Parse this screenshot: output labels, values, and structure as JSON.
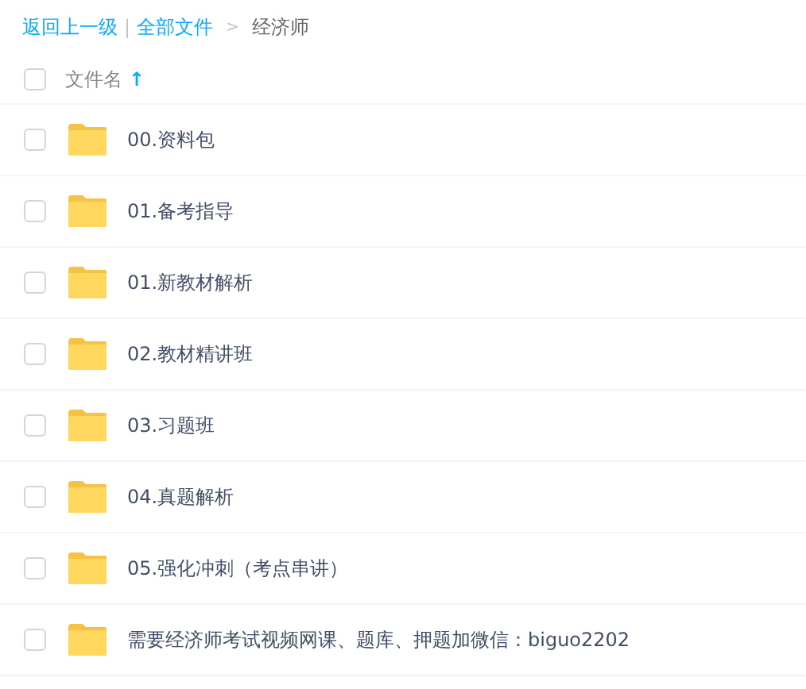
{
  "breadcrumb": {
    "back": "返回上一级",
    "separator": "|",
    "root": "全部文件",
    "arrow": ">",
    "current": "经济师"
  },
  "header": {
    "checked": false,
    "column": "文件名",
    "sort_arrow": "↑"
  },
  "files": [
    {
      "name": "00.资料包",
      "checked": false
    },
    {
      "name": "01.备考指导",
      "checked": false
    },
    {
      "name": "01.新教材解析",
      "checked": false
    },
    {
      "name": "02.教材精讲班",
      "checked": false
    },
    {
      "name": "03.习题班",
      "checked": false
    },
    {
      "name": "04.真题解析",
      "checked": false
    },
    {
      "name": "05.强化冲刺（考点串讲）",
      "checked": false
    },
    {
      "name": "需要经济师考试视频网课、题库、押题加微信：biguo2202",
      "checked": false
    }
  ]
}
